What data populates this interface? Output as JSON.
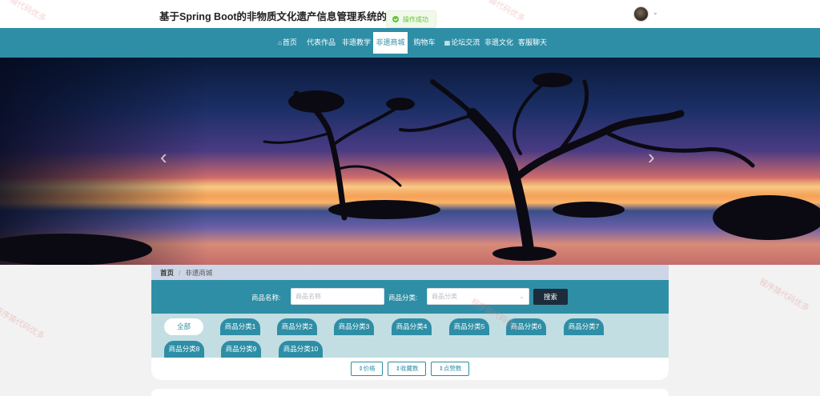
{
  "header": {
    "site_title": "基于Spring Boot的非物质文化遗产信息管理系统的设计与实现",
    "avatar_caret": "⌄"
  },
  "toast": {
    "message": "操作成功"
  },
  "nav": {
    "items": [
      {
        "icon": "⌂",
        "label": "首页"
      },
      {
        "icon": "",
        "label": "代表作品"
      },
      {
        "icon": "",
        "label": "非遗教学"
      },
      {
        "icon": "",
        "label": "非遗商城"
      },
      {
        "icon": "",
        "label": "购物车"
      },
      {
        "icon": "▦",
        "label": "论坛交流"
      },
      {
        "icon": "",
        "label": "非遗文化"
      },
      {
        "icon": "",
        "label": "客服聊天"
      }
    ],
    "active_index": 3
  },
  "banner": {
    "prev_glyph": "‹",
    "next_glyph": "›"
  },
  "breadcrumb": {
    "home": "首页",
    "separator": "/",
    "current": "非遗商城"
  },
  "search": {
    "name_label": "商品名称:",
    "name_placeholder": "商品名称",
    "category_label": "商品分类:",
    "category_placeholder": "商品分类",
    "button": "搜索"
  },
  "categories": {
    "items": [
      "全部",
      "商品分类1",
      "商品分类2",
      "商品分类3",
      "商品分类4",
      "商品分类5",
      "商品分类6",
      "商品分类7",
      "商品分类8",
      "商品分类9",
      "商品分类10"
    ],
    "active_index": 0
  },
  "sort": {
    "buttons": [
      "⇕价格",
      "⇕收藏数",
      "⇕点赞数"
    ]
  },
  "watermark": "程序猿代码优多"
}
